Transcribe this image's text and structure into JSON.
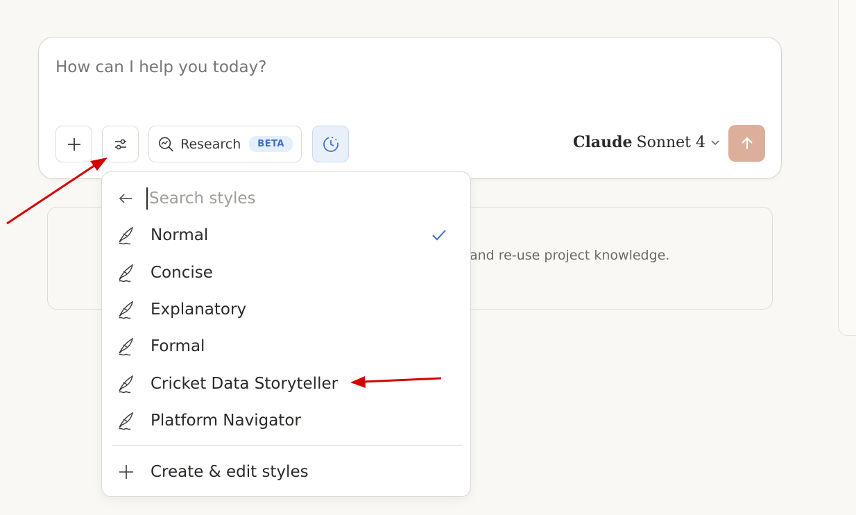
{
  "composer": {
    "placeholder": "How can I help you today?",
    "research_label": "Research",
    "beta_label": "BETA",
    "model_brand": "Claude",
    "model_name": "Sonnet 4"
  },
  "project_card": {
    "text": "and re-use project knowledge."
  },
  "style_menu": {
    "search_placeholder": "Search styles",
    "items": [
      {
        "label": "Normal",
        "selected": true
      },
      {
        "label": "Concise",
        "selected": false
      },
      {
        "label": "Explanatory",
        "selected": false
      },
      {
        "label": "Formal",
        "selected": false
      },
      {
        "label": "Cricket Data Storyteller",
        "selected": false
      },
      {
        "label": "Platform Navigator",
        "selected": false
      }
    ],
    "create_label": "Create & edit styles"
  },
  "colors": {
    "background": "#f9f8f5",
    "send_button": "#dcae9c",
    "accent_blue": "#3a6fc4",
    "annotation_arrow": "#d40000"
  },
  "icons": {
    "add": "plus-icon",
    "tools": "sliders-icon",
    "research": "research-magnifier-icon",
    "extended": "clock-icon",
    "send": "arrow-up-icon",
    "back": "arrow-left-icon",
    "style": "feather-icon",
    "selected": "check-icon",
    "create": "plus-icon"
  }
}
